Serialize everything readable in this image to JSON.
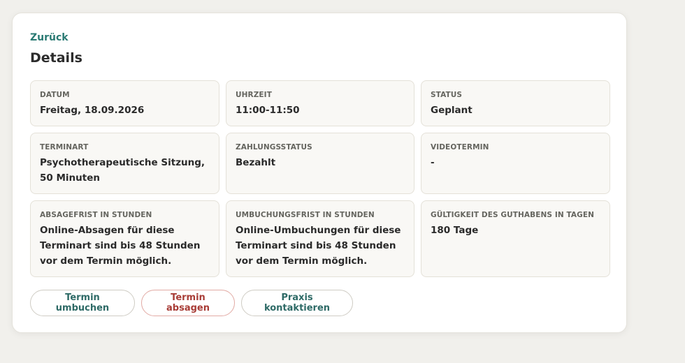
{
  "nav": {
    "back_label": "Zurück"
  },
  "page": {
    "title": "Details"
  },
  "fields": [
    {
      "label": "Datum",
      "value": "Freitag, 18.09.2026"
    },
    {
      "label": "Uhrzeit",
      "value": "11:00-11:50"
    },
    {
      "label": "Status",
      "value": "Geplant"
    },
    {
      "label": "Terminart",
      "value": "Psychotherapeutische Sitzung, 50 Minuten"
    },
    {
      "label": "Zahlungsstatus",
      "value": "Bezahlt"
    },
    {
      "label": "Videotermin",
      "value": "-"
    },
    {
      "label": "Absagefrist in Stunden",
      "value": "Online-Absagen für diese Terminart sind bis 48 Stunden vor dem Termin möglich."
    },
    {
      "label": "Umbuchungsfrist in Stunden",
      "value": "Online-Umbuchungen für diese Terminart sind bis 48 Stunden vor dem Termin möglich."
    },
    {
      "label": "Gültigkeit des Guthabens in Tagen",
      "value": "180 Tage"
    }
  ],
  "actions": {
    "reschedule_label": "Termin umbuchen",
    "cancel_label": "Termin absagen",
    "contact_label": "Praxis kontaktieren"
  },
  "colors": {
    "accent": "#2a7a73",
    "danger": "#a83c36",
    "page_background": "#f1f0ec",
    "field_background": "#f9f8f5"
  }
}
